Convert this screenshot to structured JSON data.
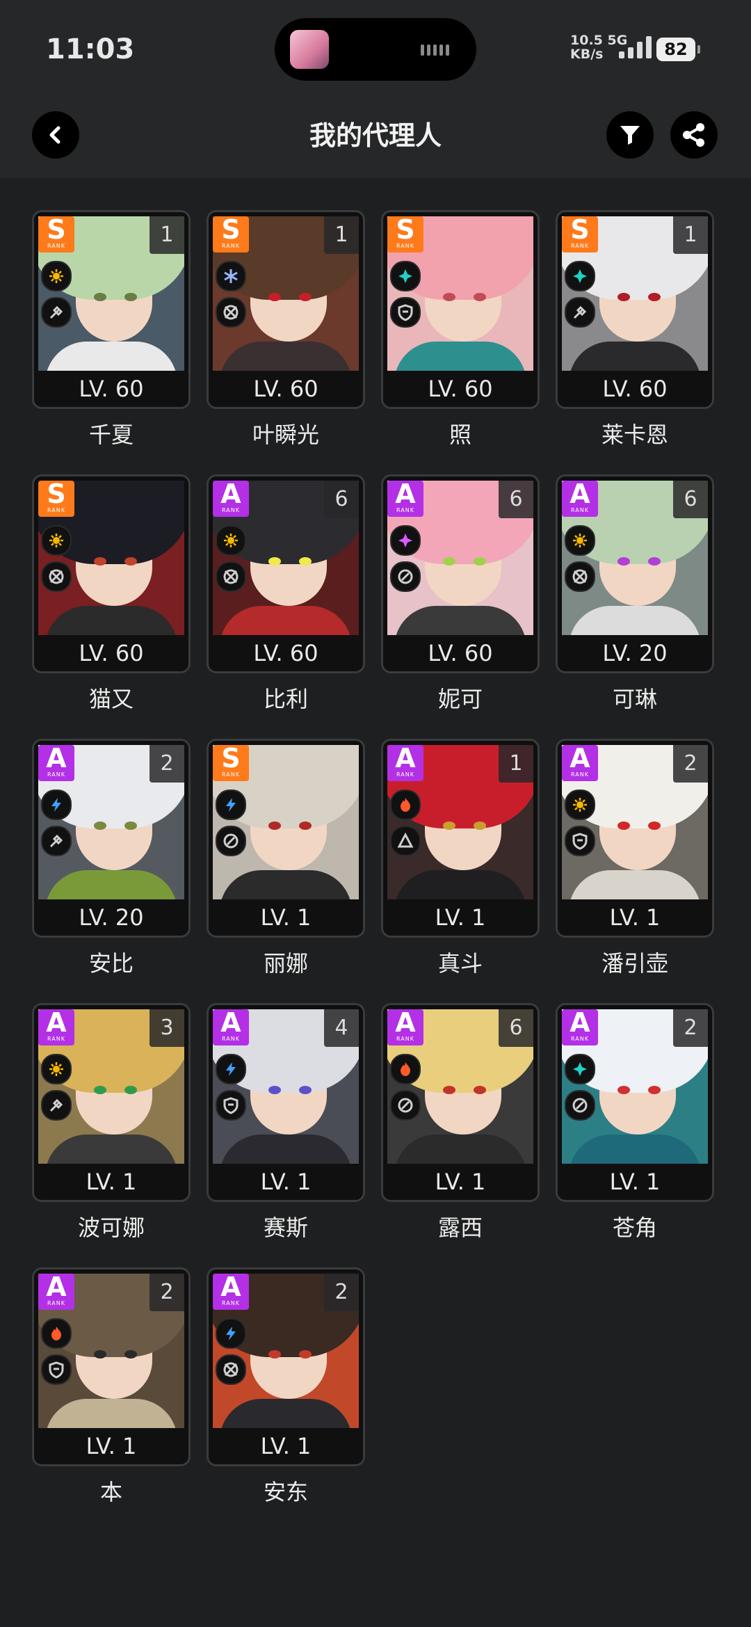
{
  "status": {
    "time": "11:03",
    "net_speed": "10.5",
    "net_unit": "KB/s",
    "net_type": "5G",
    "battery": "82"
  },
  "header": {
    "title": "我的代理人",
    "back_icon": "chevron-left-icon",
    "filter_icon": "filter-icon",
    "share_icon": "share-icon"
  },
  "colors": {
    "s_rank": "#ff7a1a",
    "a_rank": "#b330e6",
    "background": "#1e1f20"
  },
  "rank_word": "RANK",
  "agents": [
    {
      "name": "千夏",
      "level": "LV. 60",
      "rank": "S",
      "count": "1",
      "attr": "physical",
      "attr_color": "#f5b800",
      "role": "stun",
      "hair": "#b9d6a8",
      "eye": "#6a7d44",
      "outfit": "#e9e9e9",
      "bg": "#4a5a66"
    },
    {
      "name": "叶瞬光",
      "level": "LV. 60",
      "rank": "S",
      "count": "1",
      "attr": "ice",
      "attr_color": "#9bb7ff",
      "role": "attack",
      "hair": "#5a3a28",
      "eye": "#c41f2a",
      "outfit": "#3a3031",
      "bg": "#6b3a2c"
    },
    {
      "name": "照",
      "level": "LV. 60",
      "rank": "S",
      "count": "",
      "attr": "ether",
      "attr_color": "#1fd1c7",
      "role": "defense",
      "hair": "#f2a2ad",
      "eye": "#c24b58",
      "outfit": "#2e8f8f",
      "bg": "#e9b7b9"
    },
    {
      "name": "莱卡恩",
      "level": "LV. 60",
      "rank": "S",
      "count": "1",
      "attr": "ether",
      "attr_color": "#1fd1c7",
      "role": "stun",
      "hair": "#e8e8ea",
      "eye": "#b01d27",
      "outfit": "#2a2a2c",
      "bg": "#8a8a8c"
    },
    {
      "name": "猫又",
      "level": "LV. 60",
      "rank": "S",
      "count": "",
      "attr": "physical",
      "attr_color": "#f5b800",
      "role": "attack",
      "hair": "#1c1c24",
      "eye": "#c0432a",
      "outfit": "#2b2b2b",
      "bg": "#7a1f22"
    },
    {
      "name": "比利",
      "level": "LV. 60",
      "rank": "A",
      "count": "6",
      "attr": "physical",
      "attr_color": "#f5b800",
      "role": "attack",
      "hair": "#2c2c30",
      "eye": "#f2e94b",
      "outfit": "#b52a2a",
      "bg": "#5a1e1e"
    },
    {
      "name": "妮可",
      "level": "LV. 60",
      "rank": "A",
      "count": "6",
      "attr": "ether",
      "attr_color": "#d95cff",
      "role": "support",
      "hair": "#f3a6b8",
      "eye": "#9fd24a",
      "outfit": "#3a3a3a",
      "bg": "#e7c2c9"
    },
    {
      "name": "可琳",
      "level": "LV. 20",
      "rank": "A",
      "count": "6",
      "attr": "physical",
      "attr_color": "#f5b800",
      "role": "attack",
      "hair": "#b9d1b0",
      "eye": "#b23fd6",
      "outfit": "#dcdcdc",
      "bg": "#7d8a86"
    },
    {
      "name": "安比",
      "level": "LV. 20",
      "rank": "A",
      "count": "2",
      "attr": "electric",
      "attr_color": "#3fa2ff",
      "role": "stun",
      "hair": "#e9eaee",
      "eye": "#7b8a3e",
      "outfit": "#7a9a3a",
      "bg": "#555a60"
    },
    {
      "name": "丽娜",
      "level": "LV. 1",
      "rank": "S",
      "count": "",
      "attr": "electric",
      "attr_color": "#3fa2ff",
      "role": "support",
      "hair": "#d8d2c6",
      "eye": "#b12a25",
      "outfit": "#2b2b2b",
      "bg": "#bdb7ad"
    },
    {
      "name": "真斗",
      "level": "LV. 1",
      "rank": "A",
      "count": "1",
      "attr": "fire",
      "attr_color": "#ff5a2a",
      "role": "rupture",
      "hair": "#c81e2c",
      "eye": "#c8a030",
      "outfit": "#1f1f22",
      "bg": "#3a2a2a"
    },
    {
      "name": "潘引壶",
      "level": "LV. 1",
      "rank": "A",
      "count": "2",
      "attr": "physical",
      "attr_color": "#f5b800",
      "role": "defense",
      "hair": "#f1efe9",
      "eye": "#d22828",
      "outfit": "#d8d4cc",
      "bg": "#6d6a63"
    },
    {
      "name": "波可娜",
      "level": "LV. 1",
      "rank": "A",
      "count": "3",
      "attr": "physical",
      "attr_color": "#f5b800",
      "role": "stun",
      "hair": "#d9b25a",
      "eye": "#2f9a4e",
      "outfit": "#3a3a3a",
      "bg": "#8c7a4e"
    },
    {
      "name": "赛斯",
      "level": "LV. 1",
      "rank": "A",
      "count": "4",
      "attr": "electric",
      "attr_color": "#3fa2ff",
      "role": "defense",
      "hair": "#dcdde3",
      "eye": "#5b52c9",
      "outfit": "#2a2a30",
      "bg": "#4a4d55"
    },
    {
      "name": "露西",
      "level": "LV. 1",
      "rank": "A",
      "count": "6",
      "attr": "fire",
      "attr_color": "#ff5a2a",
      "role": "support",
      "hair": "#e9cf7d",
      "eye": "#c2332a",
      "outfit": "#2b2b2b",
      "bg": "#3b3a3a"
    },
    {
      "name": "苍角",
      "level": "LV. 1",
      "rank": "A",
      "count": "2",
      "attr": "ether",
      "attr_color": "#1fd1c7",
      "role": "support",
      "hair": "#eef2f6",
      "eye": "#d03030",
      "outfit": "#1f6a7a",
      "bg": "#2d7f86"
    },
    {
      "name": "本",
      "level": "LV. 1",
      "rank": "A",
      "count": "2",
      "attr": "fire",
      "attr_color": "#ff5a2a",
      "role": "defense",
      "hair": "#6b5a45",
      "eye": "#2a2a2a",
      "outfit": "#c2b294",
      "bg": "#5a4a3a"
    },
    {
      "name": "安东",
      "level": "LV. 1",
      "rank": "A",
      "count": "2",
      "attr": "electric",
      "attr_color": "#3fa2ff",
      "role": "attack",
      "hair": "#3b2a22",
      "eye": "#c43a2a",
      "outfit": "#2a2a2e",
      "bg": "#c2482a"
    }
  ]
}
